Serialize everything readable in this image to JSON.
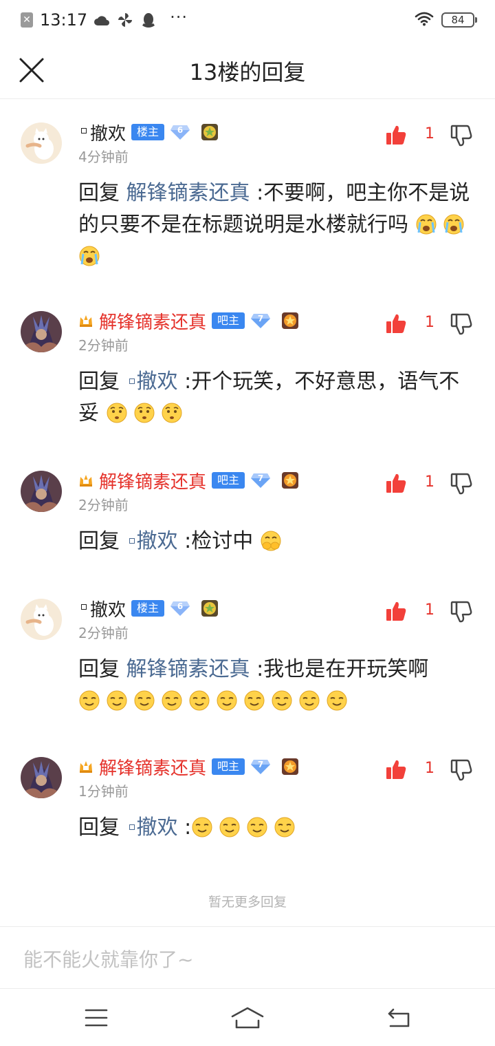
{
  "status_bar": {
    "time": "13:17",
    "battery": "84",
    "icons": [
      "sim-icon",
      "cloud-icon",
      "pinwheel-icon",
      "penguin-icon",
      "more-dots-icon",
      "wifi-icon",
      "battery-icon"
    ],
    "dots": "···"
  },
  "header": {
    "title": "13楼的回复"
  },
  "colors": {
    "accent_blue": "#3a87f0",
    "red": "#e5322b",
    "link": "#4b6a92",
    "muted": "#999999"
  },
  "replies": [
    {
      "user": "撤欢",
      "role": "楼主",
      "level": "6",
      "time": "4分钟前",
      "likes": "1",
      "reply_word": "回复",
      "target": "解锋镝素还真",
      "text": ":不要啊，吧主你不是说的只要不是在标题说明是水楼就行吗",
      "emojis": [
        "crying-emoji",
        "crying-emoji",
        "crying-emoji"
      ]
    },
    {
      "user": "解锋镝素还真",
      "role": "吧主",
      "level": "7",
      "time": "2分钟前",
      "likes": "1",
      "reply_word": "回复",
      "target": "撤欢",
      "text": ":开个玩笑，不好意思，语气不妥",
      "emojis": [
        "awkward-emoji",
        "awkward-emoji",
        "awkward-emoji"
      ]
    },
    {
      "user": "解锋镝素还真",
      "role": "吧主",
      "level": "7",
      "time": "2分钟前",
      "likes": "1",
      "reply_word": "回复",
      "target": "撤欢",
      "text": ":检讨中",
      "emojis": [
        "cover-face-emoji"
      ]
    },
    {
      "user": "撤欢",
      "role": "楼主",
      "level": "6",
      "time": "2分钟前",
      "likes": "1",
      "reply_word": "回复",
      "target": "解锋镝素还真",
      "text": ":我也是在开玩笑啊",
      "emojis": [
        "smirk-emoji",
        "smirk-emoji",
        "smirk-emoji",
        "smirk-emoji",
        "smirk-emoji",
        "smirk-emoji",
        "smirk-emoji",
        "smirk-emoji",
        "smirk-emoji",
        "smirk-emoji"
      ]
    },
    {
      "user": "解锋镝素还真",
      "role": "吧主",
      "level": "7",
      "time": "1分钟前",
      "likes": "1",
      "reply_word": "回复",
      "target": "撤欢",
      "text": ":",
      "emojis": [
        "smirk-emoji",
        "smirk-emoji",
        "smirk-emoji",
        "smirk-emoji"
      ]
    }
  ],
  "no_more": "暂无更多回复",
  "input": {
    "placeholder": "能不能火就靠你了~"
  },
  "nav": [
    "menu-icon",
    "home-icon",
    "back-icon"
  ]
}
